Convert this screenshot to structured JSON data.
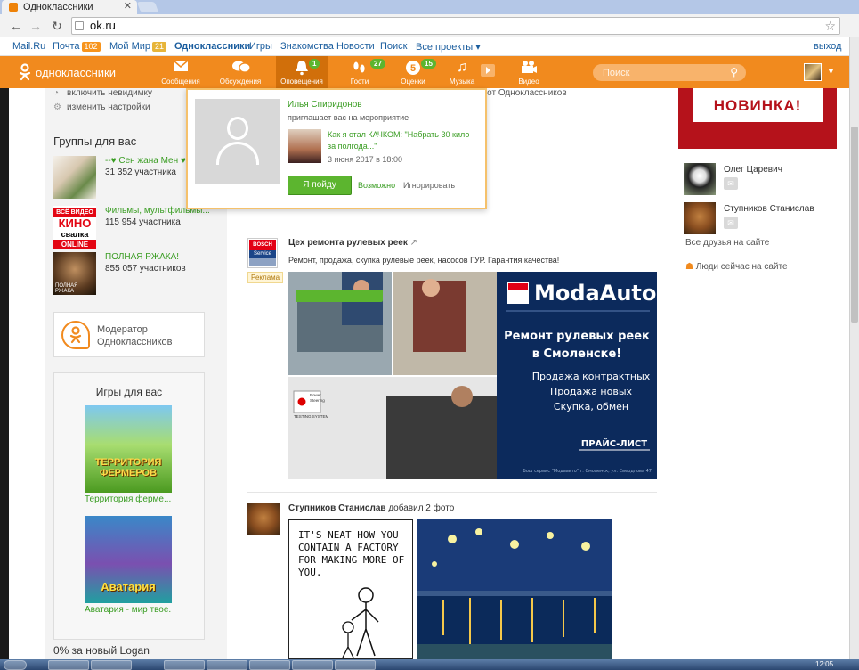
{
  "browser": {
    "tab_title": "Одноклассники",
    "address": "ok.ru"
  },
  "portal": {
    "items": [
      {
        "label": "Mail.Ru"
      },
      {
        "label": "Почта",
        "badge": "102"
      },
      {
        "label": "Мой Мир",
        "badge": "21"
      },
      {
        "label": "Одноклассники"
      },
      {
        "label": "Игры"
      },
      {
        "label": "Знакомства"
      },
      {
        "label": "Новости"
      },
      {
        "label": "Поиск"
      },
      {
        "label": "Все проекты ▾"
      }
    ],
    "exit": "выход"
  },
  "header": {
    "logo": "одноклассники",
    "nav": [
      {
        "label": "Сообщения",
        "icon": "envelope-icon"
      },
      {
        "label": "Обсуждения",
        "icon": "chat-icon"
      },
      {
        "label": "Оповещения",
        "icon": "bell-icon",
        "count": "1"
      },
      {
        "label": "Гости",
        "icon": "footprints-icon",
        "count": "27"
      },
      {
        "label": "Оценки",
        "icon": "rating-icon",
        "count": "15"
      },
      {
        "label": "Музыка",
        "icon": "music-icon"
      },
      {
        "label": "Видео",
        "icon": "video-icon"
      }
    ],
    "search_placeholder": "Поиск"
  },
  "left": {
    "invisible": "включить невидимку",
    "settings": "изменить настройки",
    "groups_title": "Группы для вас",
    "groups": [
      {
        "name": "--♥ Сен жана Мен ♥--",
        "count": "31 352 участника"
      },
      {
        "name": "Фильмы, мультфильмы...",
        "count": "115 954 участника",
        "logo_lines": [
          "ВСЁ ВИДЕО",
          "КИНО",
          "свалка",
          "ONLINE"
        ]
      },
      {
        "name": "ПОЛНАЯ РЖАКА!",
        "count": "855 057 участников",
        "thumb_text": "ПОЛНАЯ РЖАКА"
      }
    ],
    "moderator": "Модератор Одноклассников",
    "games_title": "Игры для вас",
    "games": [
      {
        "caption": "Территория ферме...",
        "pic_text": "ТЕРРИТОРИЯ ФЕРМЕРОВ"
      },
      {
        "caption": "Аватария - мир твое...",
        "pic_text": "Аватария"
      }
    ],
    "promo": "0% за новый Logan"
  },
  "feed": {
    "top_text": "... от Одноклассников",
    "ad": {
      "title": "Цех ремонта рулевых реек",
      "desc": "Ремонт, продажа, скупка рулевые реек, насосов ГУР. Гарантия качества!",
      "tag": "Реклама",
      "logo_brand": "BOSCH",
      "logo_sub": "Service",
      "banner_brand": "ModaAuto",
      "banner_headline": "Ремонт рулевых реек в Смоленске!",
      "banner_lines": [
        "Продажа контрактных",
        "Продажа новых",
        "Скупка, обмен"
      ],
      "banner_cta": "ПРАЙС-ЛИСТ",
      "banner_footer": "Бош сервис \"Модаавто\" г. Смоленск, ул. Свердлова 47",
      "equipment_label": [
        "Power",
        "Steering",
        "TESTING SYSTEM"
      ]
    },
    "post2": {
      "author": "Ступников Станислав",
      "action": "добавил 2 фото",
      "comic_text": "IT'S NEAT HOW YOU CONTAIN A FACTORY FOR MAKING MORE OF YOU."
    }
  },
  "popup": {
    "who": "Илья Спиридонов",
    "action": "приглашает вас на мероприятие",
    "event": "Как я стал КАЧКОМ: \"Набрать 30 кило за полгода...\"",
    "date": "3 июня 2017 в 18:00",
    "go": "Я пойду",
    "maybe": "Возможно",
    "ignore": "Игнорировать"
  },
  "right": {
    "banner": "НОВИНКА!",
    "friends": [
      {
        "name": "Олег Царевич"
      },
      {
        "name": "Ступников Станислав"
      }
    ],
    "all_friends": "Все друзья на сайте",
    "people_now": "Люди сейчас на сайте"
  },
  "taskbar": {
    "clock": "12:05"
  }
}
